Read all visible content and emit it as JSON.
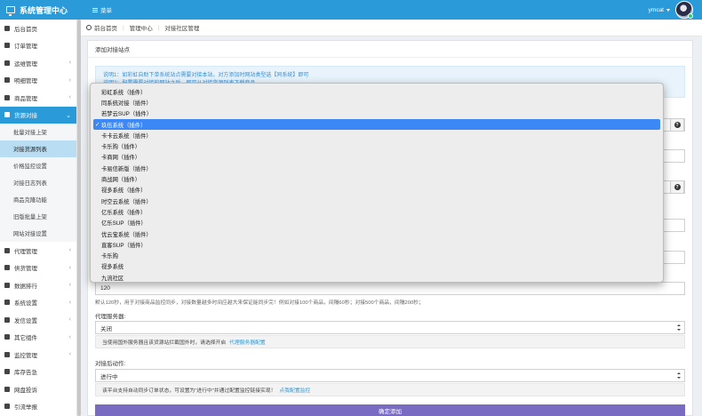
{
  "topbar": {
    "brand": "系统管理中心",
    "menu_label": "菜单",
    "username": "ymcat"
  },
  "sidebar": {
    "items": [
      {
        "label": "后台首页",
        "icon": "home-icon",
        "arrow": ""
      },
      {
        "label": "订单管理",
        "icon": "list-icon",
        "arrow": ""
      },
      {
        "label": "运维管理",
        "icon": "comments-icon",
        "arrow": "‹"
      },
      {
        "label": "明细管理",
        "icon": "bars-icon",
        "arrow": "‹"
      },
      {
        "label": "商品管理",
        "icon": "grid-icon",
        "arrow": "‹"
      },
      {
        "label": "货源对接",
        "icon": "box-icon",
        "arrow": "⌄"
      }
    ],
    "subitems": [
      "批量对接上架",
      "对接货源列表",
      "价格监控设置",
      "对接日志列表",
      "商品克隆功能",
      "旧版批量上架",
      "网站对接设置"
    ],
    "items_after": [
      {
        "label": "代理管理",
        "icon": "sitemap-icon",
        "arrow": "‹"
      },
      {
        "label": "供货管理",
        "icon": "users-icon",
        "arrow": "‹"
      },
      {
        "label": "数据排行",
        "icon": "chart-icon",
        "arrow": "‹"
      },
      {
        "label": "系统设置",
        "icon": "cogs-icon",
        "arrow": "‹"
      },
      {
        "label": "发信设置",
        "icon": "envelope-icon",
        "arrow": "‹"
      },
      {
        "label": "其它组件",
        "icon": "puzzle-icon",
        "arrow": "‹"
      },
      {
        "label": "监控管理",
        "icon": "refresh-icon",
        "arrow": "‹"
      },
      {
        "label": "库存告急",
        "icon": "bell-icon",
        "arrow": ""
      },
      {
        "label": "网盘投诉",
        "icon": "inbox-icon",
        "arrow": ""
      },
      {
        "label": "引流举报",
        "icon": "download-icon",
        "arrow": ""
      }
    ]
  },
  "breadcrumb": {
    "home": "前台首页",
    "level1": "管理中心",
    "level2": "对接社区管理"
  },
  "panel": {
    "title": "添加对接站点",
    "alert_line1": "说明1：如彩虹自助下单系统站点需要对接本站，对方添加时网站类型选【同系统】即可",
    "alert_line2": "说明2：配置需要对接的网站之后，即可从对接货源列表下载商品",
    "monitor_value": "120",
    "monitor_help": "默认120秒，用于对接商品监控同步，对接数量越多时间应越大来保证能同步完！例如对接100个商品，间隔60秒；对接500个商品，间隔200秒；",
    "proxy_label": "代理服务器:",
    "proxy_value": "关闭",
    "proxy_note": "当使用国外服务器且该货源站拦截国外时，请选择开启",
    "proxy_link": "代理服务器配置",
    "after_label": "对接后动作:",
    "after_value": "进行中",
    "after_note": "该平台支持自动同步订单状态，可设置为\"进行中\"并通过配置监控链接实现！",
    "after_link": "点我配置监控",
    "submit": "确定添加"
  },
  "dropdown": {
    "selected_index": 3,
    "options": [
      "彩虹系统（插件）",
      "同系统对接（插件）",
      "若梦云SUP（插件）",
      "玖伍系统（插件）",
      "卡卡云系统（插件）",
      "卡乐购（插件）",
      "卡商网（插件）",
      "卡易信新版（插件）",
      "商战网（插件）",
      "视多系统（插件）",
      "时空云系统（插件）",
      "亿乐系统（插件）",
      "亿乐SUP（插件）",
      "优云宝系统（插件）",
      "直客SUP（插件）",
      "卡乐购",
      "视多系统",
      "九流社区"
    ]
  }
}
